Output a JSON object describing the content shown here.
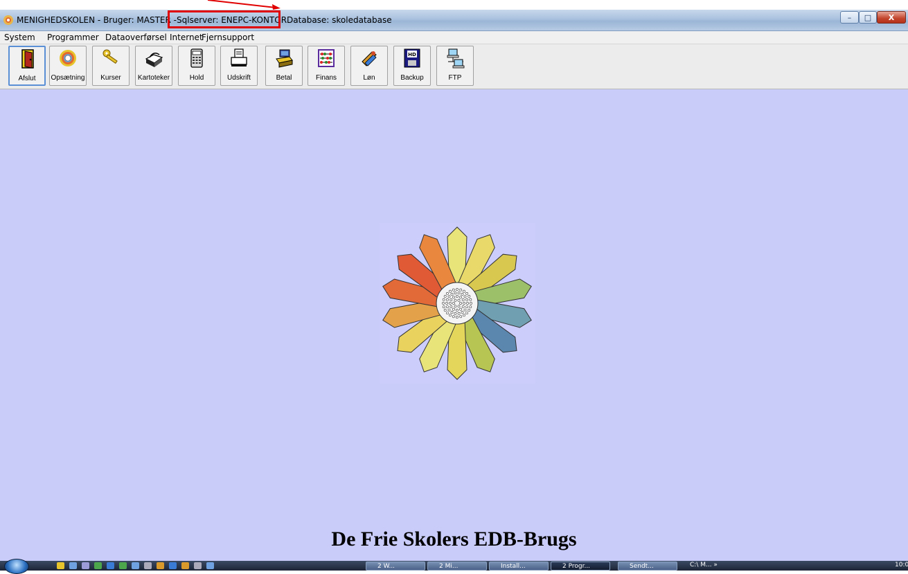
{
  "window": {
    "title_parts": [
      "MENIGHEDSKOLEN - Bruger: MASTER - ",
      "Sqlserver: ENEPC-KONTOR",
      " Database: skoledatabase"
    ],
    "controls": {
      "minimize": "–",
      "maximize": "□",
      "close": "X"
    }
  },
  "menu": [
    {
      "label": "System"
    },
    {
      "label": "Programmer"
    },
    {
      "label": "Dataoverførsel"
    },
    {
      "label": "Internet"
    },
    {
      "label": "Fjernsupport"
    }
  ],
  "toolbar": [
    {
      "label": "Afslut",
      "icon": "door-exit-icon"
    },
    {
      "label": "Opsætning",
      "icon": "flower-settings-icon"
    },
    {
      "label": "Kurser",
      "icon": "keys-icon"
    },
    {
      "label": "Kartoteker",
      "icon": "card-file-icon"
    },
    {
      "label": "Hold",
      "icon": "calculator-icon"
    },
    {
      "label": "Udskrift",
      "icon": "printer-icon"
    },
    {
      "label": "Betal",
      "icon": "cash-register-icon"
    },
    {
      "label": "Finans",
      "icon": "abacus-icon"
    },
    {
      "label": "Løn",
      "icon": "money-icon"
    },
    {
      "label": "Backup",
      "icon": "hd-disk-icon"
    },
    {
      "label": "FTP",
      "icon": "network-computers-icon"
    }
  ],
  "main": {
    "footer_title": "De Frie Skolers EDB-Brugs"
  },
  "taskbar": {
    "tasks": [
      {
        "label": "2 W..."
      },
      {
        "label": "2 Mi..."
      },
      {
        "label": "Install..."
      },
      {
        "label": "2 Progr..."
      },
      {
        "label": "Sendt..."
      }
    ],
    "tray_text": "C:\\ M... »",
    "clock": "10:0"
  }
}
